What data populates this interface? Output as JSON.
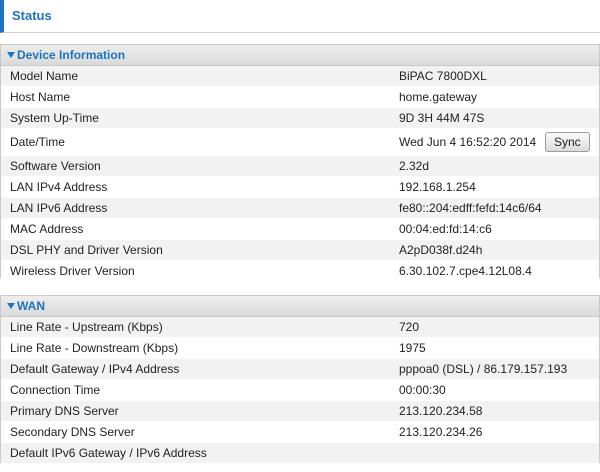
{
  "page": {
    "title": "Status"
  },
  "device_information": {
    "title": "Device Information",
    "rows": [
      {
        "label": "Model Name",
        "value": "BiPAC 7800DXL"
      },
      {
        "label": "Host Name",
        "value": "home.gateway"
      },
      {
        "label": "System Up-Time",
        "value": "9D 3H 44M 47S"
      },
      {
        "label": "Date/Time",
        "value": "Wed Jun 4 16:52:20 2014"
      },
      {
        "label": "Software Version",
        "value": "2.32d"
      },
      {
        "label": "LAN IPv4 Address",
        "value": "192.168.1.254"
      },
      {
        "label": "LAN IPv6 Address",
        "value": "fe80::204:edff:fefd:14c6/64"
      },
      {
        "label": "MAC Address",
        "value": "00:04:ed:fd:14:c6"
      },
      {
        "label": "DSL PHY and Driver Version",
        "value": "A2pD038f.d24h"
      },
      {
        "label": "Wireless Driver Version",
        "value": "6.30.102.7.cpe4.12L08.4"
      }
    ],
    "sync_button": "Sync"
  },
  "wan": {
    "title": "WAN",
    "rows": [
      {
        "label": "Line Rate - Upstream (Kbps)",
        "value": "720"
      },
      {
        "label": "Line Rate - Downstream (Kbps)",
        "value": "1975"
      },
      {
        "label": "Default Gateway / IPv4 Address",
        "value": "pppoa0 (DSL) / 86.179.157.193"
      },
      {
        "label": "Connection Time",
        "value": "00:00:30"
      },
      {
        "label": "Primary DNS Server",
        "value": "213.120.234.58"
      },
      {
        "label": "Secondary DNS Server",
        "value": "213.120.234.26"
      },
      {
        "label": "Default IPv6 Gateway / IPv6 Address",
        "value": ""
      }
    ]
  },
  "colors": {
    "accent": "#1e73be",
    "row_alt": "#f2f2f2",
    "header_bg": "#dadada"
  }
}
